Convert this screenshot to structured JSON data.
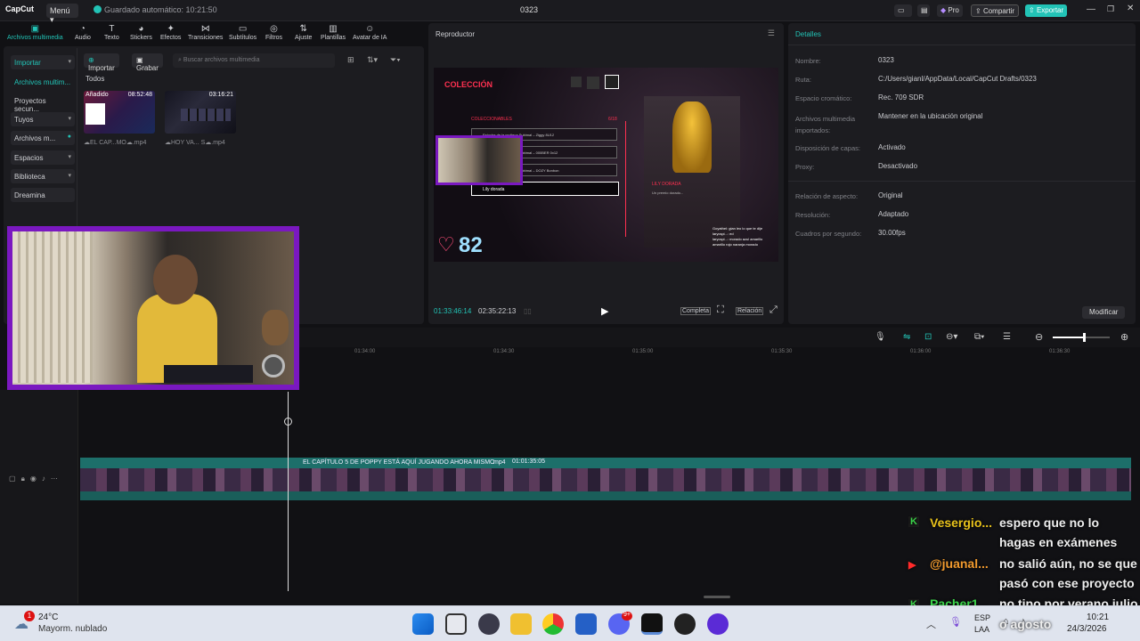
{
  "titlebar": {
    "app_name": "CapCut",
    "menu_label": "Menú",
    "autosave": "Guardado automático: 10:21:50",
    "project_title": "0323",
    "pro_label": "Pro",
    "share_label": "Compartir",
    "export_label": "Exportar"
  },
  "tools": [
    {
      "label": "Archivos multimedia",
      "icon": "media-icon"
    },
    {
      "label": "Audio",
      "icon": "audio-icon"
    },
    {
      "label": "Texto",
      "icon": "text-icon"
    },
    {
      "label": "Stickers",
      "icon": "sticker-icon"
    },
    {
      "label": "Efectos",
      "icon": "effects-icon"
    },
    {
      "label": "Transiciones",
      "icon": "transitions-icon"
    },
    {
      "label": "Subtítulos",
      "icon": "subtitles-icon"
    },
    {
      "label": "Filtros",
      "icon": "filters-icon"
    },
    {
      "label": "Ajuste",
      "icon": "adjust-icon"
    },
    {
      "label": "Plantillas",
      "icon": "templates-icon"
    },
    {
      "label": "Avatar de IA",
      "icon": "ai-avatar-icon"
    }
  ],
  "leftnav": {
    "import": "Importar",
    "media": "Archivos multim...",
    "projects": "Proyectos secun...",
    "yours": "Tuyos",
    "media2": "Archivos m...",
    "spaces": "Espacios",
    "library": "Biblioteca",
    "dreamina": "Dreamina"
  },
  "media": {
    "import_btn": "Importar",
    "record_btn": "Grabar",
    "search_placeholder": "Buscar archivos multimedia",
    "all_label": "Todos",
    "items": [
      {
        "added": "Añadido",
        "duration": "08:52:48",
        "name": "EL CAP...MO",
        "ext": ".mp4"
      },
      {
        "added": "",
        "duration": "03:16:21",
        "name": "HOY VA... S",
        "ext": ".mp4"
      }
    ]
  },
  "player": {
    "title": "Reproductor",
    "current_time": "01:33:46:14",
    "total_time": "02:35:22:13",
    "full_label": "Completa",
    "ratio_label": "Relación",
    "screen": {
      "heading": "COLECCIÓN",
      "collectibles": "COLECCIONABLES",
      "count": "6/18",
      "rows": [
        "Estuche de la muñeca Subimal – Ziggy 8U12",
        "Estuche de la muñeca Subimal – 000BER 0x12",
        "Estuche de la muñeca Subimal – DOZY Bonbon",
        "Lily dorada"
      ],
      "trophy_label": "LILY DORADA",
      "trophy_desc": "Un premio dorado...",
      "likes": "82",
      "chat_lines": [
        "Goyathel: gian leo lo que te dije",
        "larycspi...: ed",
        "larycspi...: morado azul amarillo",
        "amarillo rojo naranja morado"
      ]
    }
  },
  "details": {
    "title": "Detalles",
    "rows": [
      {
        "k": "Nombre:",
        "v": "0323"
      },
      {
        "k": "Ruta:",
        "v": "C:/Users/gianl/AppData/Local/CapCut Drafts/0323"
      },
      {
        "k": "Espacio cromático:",
        "v": "Rec. 709 SDR"
      },
      {
        "k": "Archivos multimedia importados:",
        "v": "Mantener en la ubicación original"
      },
      {
        "k": "Disposición de capas:",
        "v": "Activado"
      },
      {
        "k": "Proxy:",
        "v": "Desactivado"
      },
      {
        "k": "Relación de aspecto:",
        "v": "Original"
      },
      {
        "k": "Resolución:",
        "v": "Adaptado"
      },
      {
        "k": "Cuadros por segundo:",
        "v": "30.00fps"
      }
    ],
    "modify_btn": "Modificar"
  },
  "timeline": {
    "ticks": [
      "01:34:00",
      "01:34:30",
      "01:35:00",
      "01:35:30",
      "01:36:00",
      "01:36:30"
    ],
    "clip_title": "EL CAPÍTULO 5 DE POPPY ESTÁ AQUÍ JUGANDO AHORA MISMO",
    "clip_ext": ".mp4",
    "clip_time": "01:01:35:05",
    "zoom_level": 0.55
  },
  "chat": [
    {
      "user": "Vesergio...",
      "msg": "espero que no lo",
      "platform": "kick",
      "color": "#e8c21b"
    },
    {
      "user": "",
      "msg": "hagas en exámenes",
      "platform": "",
      "color": "#eee"
    },
    {
      "user": "@juanal...",
      "msg": "no salió aún, no se que",
      "platform": "youtube",
      "color": "#f39b2e"
    },
    {
      "user": "",
      "msg": "pasó con ese proyecto",
      "platform": "",
      "color": "#eee"
    },
    {
      "user": "Pacher1...",
      "msg": "no tipo por verano julio",
      "platform": "kick",
      "color": "#3bd34a"
    },
    {
      "user": "",
      "msg": "o agosto",
      "platform": "",
      "color": "#eee"
    }
  ],
  "taskbar": {
    "temp": "24°C",
    "weather": "Mayorm. nublado",
    "weather_badge": "1",
    "lang1": "ESP",
    "lang2": "LAA",
    "time": "10:21",
    "date": "24/3/2026",
    "discord_badge": "9+"
  },
  "colors": {
    "accent": "#22c3b6",
    "webcam_border": "#7a18c0",
    "likes_pink": "#ff4f7a"
  }
}
